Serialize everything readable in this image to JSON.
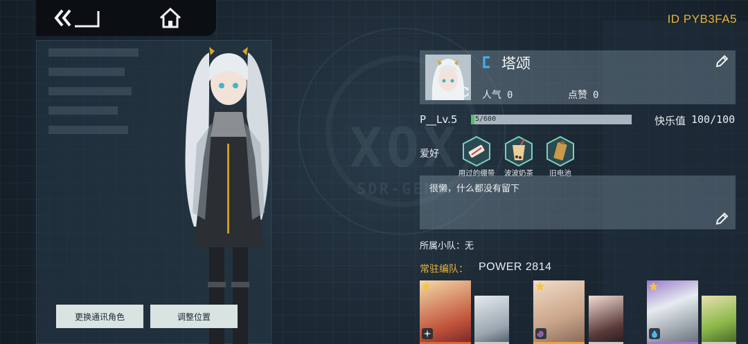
{
  "header": {
    "id_text": "ID PYB3FA5",
    "back_icon": "double-chevron-back-icon",
    "home_icon": "home-icon"
  },
  "left_actions": {
    "change_character": "更换通讯角色",
    "adjust_position": "调整位置"
  },
  "profile": {
    "name": "塔颂",
    "popularity_label": "人气",
    "popularity_value": "0",
    "likes_label": "点赞",
    "likes_value": "0",
    "level_label": "P__Lv.5",
    "exp_text": "5/600",
    "exp_fraction": 0.0083,
    "happiness_label": "快乐值",
    "happiness_value": "100/100"
  },
  "hobbies": {
    "label": "爱好",
    "items": [
      {
        "name": "用过的绷带",
        "icon": "bandage-icon"
      },
      {
        "name": "波波奶茶",
        "icon": "bubble-tea-icon"
      },
      {
        "name": "旧电池",
        "icon": "battery-icon"
      }
    ]
  },
  "bio": {
    "text": "很懒，什么都没有留下"
  },
  "squad": {
    "text": "所属小队：无"
  },
  "formation": {
    "label": "常驻编队：",
    "power_text": "POWER  2814",
    "members": [
      {
        "role": "leader",
        "element": "light",
        "accent": "#e0672a"
      },
      {
        "role": "support",
        "element": "none",
        "accent": "#c9c9c9"
      },
      {
        "role": "leader",
        "element": "psychic",
        "accent": "#f0a23a"
      },
      {
        "role": "support",
        "element": "none",
        "accent": "#c9c9c9"
      },
      {
        "role": "leader",
        "element": "water",
        "accent": "#9f7ad6"
      },
      {
        "role": "support",
        "element": "none",
        "accent": "#c9c9c9"
      }
    ]
  },
  "colors": {
    "accent_gold": "#e8b43a",
    "exp_green": "#53c16a",
    "class_blue": "#3db4f0"
  }
}
